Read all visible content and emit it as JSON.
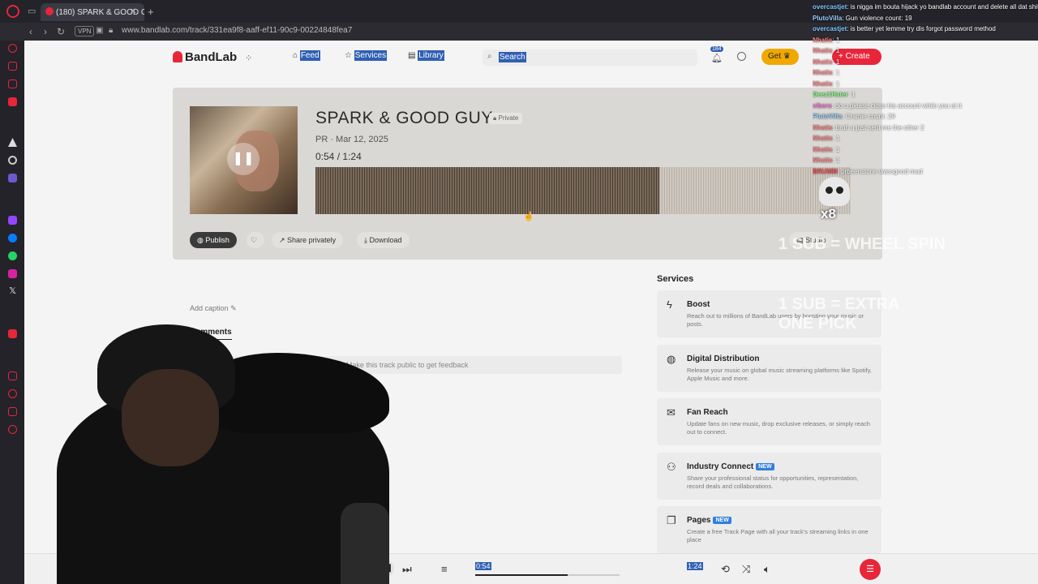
{
  "browser": {
    "tab_title": "(180) SPARK & GOOD GUY",
    "vpn_label": "VPN",
    "url": "www.bandlab.com/track/331ea9f8-aaff-ef11-90c9-00224848fea7"
  },
  "header": {
    "logo": "BandLab",
    "nav": [
      "Feed",
      "Services",
      "Library"
    ],
    "search_placeholder": "Search",
    "notification_count": "184",
    "get_label": "Get",
    "create_label": "+ Create"
  },
  "track": {
    "title": "SPARK & GOOD GUY",
    "visibility": "Private",
    "meta": "PR · Mar 12, 2025",
    "current_time": "0:54",
    "separator": "/",
    "duration": "1:24",
    "progress": 0.643,
    "actions": [
      "Publish",
      "Share privately",
      "Download",
      "Studio"
    ]
  },
  "caption_label": "Add caption",
  "comments_tab": "Comments",
  "feedback_hint": "Make this track public to get feedback",
  "services": {
    "heading": "Services",
    "items": [
      {
        "name": "Boost",
        "icon": "bolt-icon",
        "new": "",
        "desc": "Reach out to millions of BandLab users by boosting your music or posts."
      },
      {
        "name": "Digital Distribution",
        "icon": "globe-icon",
        "new": "",
        "desc": "Release your music on global music streaming platforms like Spotify, Apple Music and more."
      },
      {
        "name": "Fan Reach",
        "icon": "mail-icon",
        "new": "",
        "desc": "Update fans on new music, drop exclusive releases, or simply reach out to connect."
      },
      {
        "name": "Industry Connect",
        "icon": "people-icon",
        "new": "NEW",
        "desc": "Share your professional status for opportunities, representation, record deals and collaborations."
      },
      {
        "name": "Pages",
        "icon": "pages-icon",
        "new": "NEW",
        "desc": "Create a free Track Page with all your track's streaming links in one place"
      }
    ]
  },
  "player": {
    "current_time": "0:54",
    "duration": "1:24",
    "progress": 0.643
  },
  "chat": [
    {
      "user": "overcastjet",
      "text": ": is nigga im bouta hijack yo bandlab account and delete all dat shit",
      "color": "#7fc6ff"
    },
    {
      "user": "PlutoVilla",
      "text": ": Gun violence count: 19",
      "color": "#9ad0ff"
    },
    {
      "user": "overcastjet",
      "text": ": is better yet lemme try dis forgot password method",
      "color": "#7fc6ff"
    },
    {
      "user": "Nhatis",
      "text": ": 1",
      "color": "#ff8a8a"
    },
    {
      "user": "Nhatis",
      "text": ": 1",
      "color": "#ff8a8a"
    },
    {
      "user": "Nhatis",
      "text": ": 1",
      "color": "#ff8a8a"
    },
    {
      "user": "Nhatis",
      "text": ": 1",
      "color": "#ff8a8a"
    },
    {
      "user": "Nhatis",
      "text": ": 1",
      "color": "#ff8a8a"
    },
    {
      "user": "Deez1Hater",
      "text": ": 1",
      "color": "#8aff8a"
    },
    {
      "user": "vibers",
      "text": ": do u please close his account while you at it",
      "color": "#ff7ad9"
    },
    {
      "user": "PlutoVilla",
      "text": ": Cramie count: 29",
      "color": "#9ad0ff"
    },
    {
      "user": "Nhatis",
      "text": ": bruh u just sent me the other 2",
      "color": "#ff8a8a"
    },
    {
      "user": "Nhatis",
      "text": ": 1",
      "color": "#ff8a8a"
    },
    {
      "user": "Nhatis",
      "text": ": 1",
      "color": "#ff8a8a"
    },
    {
      "user": "Nhatis",
      "text": ": 1",
      "color": "#ff8a8a"
    },
    {
      "user": "BRUMM",
      "text": ": prbeenstone wassgood mud",
      "color": "#ff5555"
    }
  ],
  "overlay": {
    "line1": "1 SUB = WHEEL SPIN",
    "line2": "1 SUB = EXTRA",
    "line3": "ONE PICK",
    "multiplier": "x8"
  },
  "colors": {
    "brand": "#e8263a",
    "selection": "#2f5fb3",
    "get": "#f0a800"
  }
}
